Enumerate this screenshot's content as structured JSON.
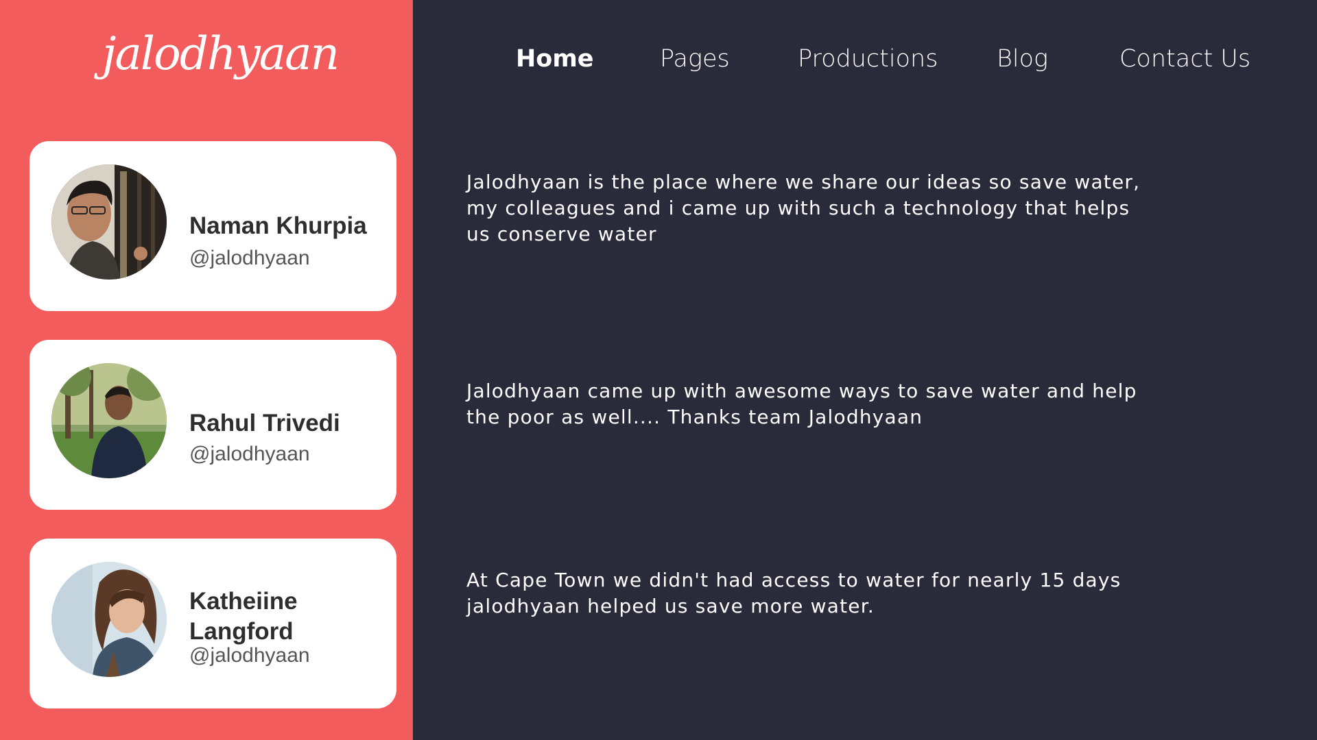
{
  "brand": {
    "logo_text": "jalodhyaan"
  },
  "nav": {
    "items": [
      {
        "label": "Home",
        "active": true
      },
      {
        "label": "Pages",
        "active": false
      },
      {
        "label": "Productions",
        "active": false
      },
      {
        "label": "Blog",
        "active": false
      },
      {
        "label": "Contact Us",
        "active": false
      }
    ]
  },
  "testimonials": [
    {
      "name": "Naman Khurpia",
      "handle": "@jalodhyaan",
      "quote": "Jalodhyaan is the place where we share our ideas so save water, my colleagues and i came up with such a technology that helps us conserve water"
    },
    {
      "name": "Rahul Trivedi",
      "handle": "@jalodhyaan",
      "quote": "Jalodhyaan came up with awesome ways to save water and help the poor as well.... Thanks team Jalodhyaan"
    },
    {
      "name": "Katheiine Langford",
      "handle": "@jalodhyaan",
      "quote": "At Cape Town we didn't had access to water for nearly 15 days jalodhyaan helped us save more water."
    }
  ],
  "colors": {
    "left_panel": "#f25c5c",
    "main_background": "#292b3b",
    "card": "#ffffff"
  }
}
